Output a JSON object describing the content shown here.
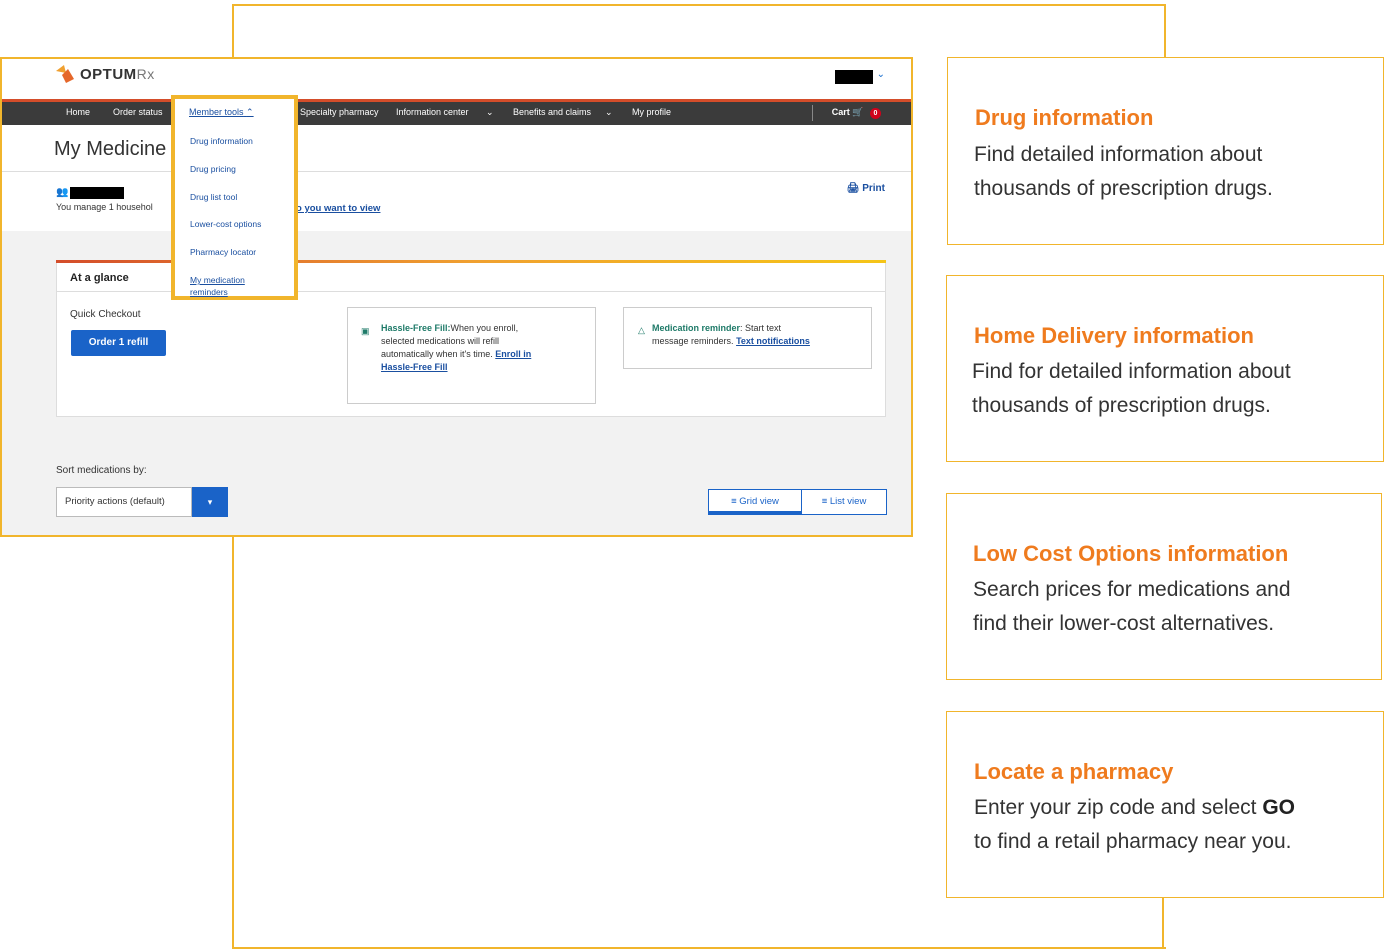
{
  "app": {
    "logo_text": "OPTUM",
    "logo_suffix": "Rx",
    "account_chevron": "chevron-down-icon"
  },
  "nav": {
    "items": [
      "Home",
      "Order status",
      "Member tools",
      "Specialty pharmacy",
      "Information center",
      "Benefits and claims",
      "My profile"
    ],
    "cart_label": "Cart",
    "cart_count": "0"
  },
  "dropdown": {
    "header": "Member tools",
    "items": [
      "Drug information",
      "Drug pricing",
      "Drug list tool",
      "Lower-cost options",
      "Pharmacy locator",
      "My medication reminders"
    ]
  },
  "page": {
    "title": "My Medicine",
    "household_text": "You manage 1 househol",
    "household_link": "o you want to view",
    "print_label": "Print"
  },
  "glance": {
    "title": "At a glance",
    "quick_checkout": "Quick Checkout",
    "order_button": "Order 1 refill",
    "hassle_title": "Hassle-Free Fill:",
    "hassle_body_1": "When you enroll,",
    "hassle_body_2": "selected medications will refill",
    "hassle_body_3": "automatically when it's time.",
    "hassle_link_1": "Enroll in",
    "hassle_link_2": "Hassle-Free Fill",
    "reminder_title": "Medication reminder",
    "reminder_body_1": ": Start text",
    "reminder_body_2": "message reminders.",
    "reminder_link": "Text notifications"
  },
  "sort": {
    "label": "Sort medications by:",
    "selected": "Priority actions (default)",
    "grid_view": "Grid view",
    "list_view": "List view"
  },
  "callouts": [
    {
      "title": "Drug information",
      "body": [
        "Find detailed information about",
        "thousands of prescription drugs."
      ]
    },
    {
      "title": "Home Delivery information",
      "body": [
        "Find for detailed information about",
        "thousands of prescription drugs."
      ]
    },
    {
      "title": "Low Cost Options information",
      "body": [
        "Search prices for medications and",
        "find their lower-cost alternatives."
      ]
    },
    {
      "title": "Locate a pharmacy",
      "body_pre": "Enter your zip code and select ",
      "body_bold": "GO",
      "body_2": "to find a retail pharmacy near you."
    }
  ],
  "colors": {
    "accent_orange": "#f1b52c",
    "title_orange": "#ef7b1e",
    "nav_dark": "#3b3b3b",
    "brand_blue": "#1a63c8"
  }
}
